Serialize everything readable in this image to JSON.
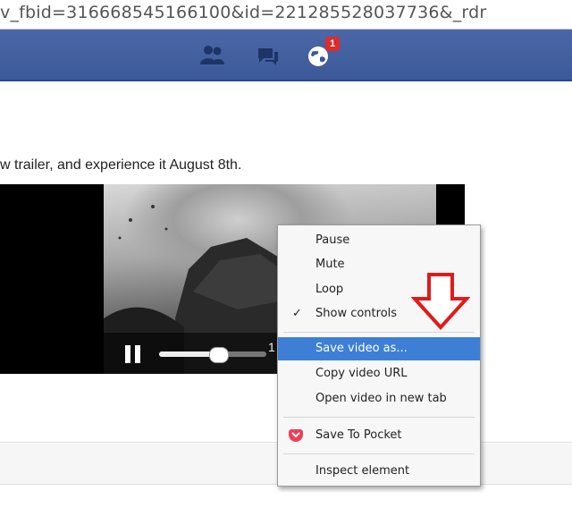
{
  "address_bar": {
    "url": "v_fbid=316668545166100&id=221285528037736&_rdr"
  },
  "top_nav": {
    "icons": [
      "friend-requests-icon",
      "messages-icon",
      "notifications-globe-icon"
    ],
    "notification_count": "1",
    "colors": {
      "bar": "#3b5998",
      "badge": "#e02b2b"
    }
  },
  "post": {
    "caption": "w trailer, and experience it August 8th.",
    "video": {
      "time_partial": "1",
      "progress": 0.55
    }
  },
  "context_menu": {
    "items": [
      {
        "label": "Pause",
        "checked": false
      },
      {
        "label": "Mute",
        "checked": false
      },
      {
        "label": "Loop",
        "checked": false
      },
      {
        "label": "Show controls",
        "checked": true
      },
      {
        "label": "Save video as...",
        "highlighted": true
      },
      {
        "label": "Copy video URL"
      },
      {
        "label": "Open video in new tab"
      },
      {
        "label": "Save To Pocket",
        "icon": "pocket-icon"
      },
      {
        "label": "Inspect element"
      }
    ],
    "check_glyph": "✓",
    "highlight_color": "#3d7fd6"
  },
  "annotation": {
    "arrow_color": "#e01b1b",
    "arrow_icon": "down-arrow-icon"
  }
}
